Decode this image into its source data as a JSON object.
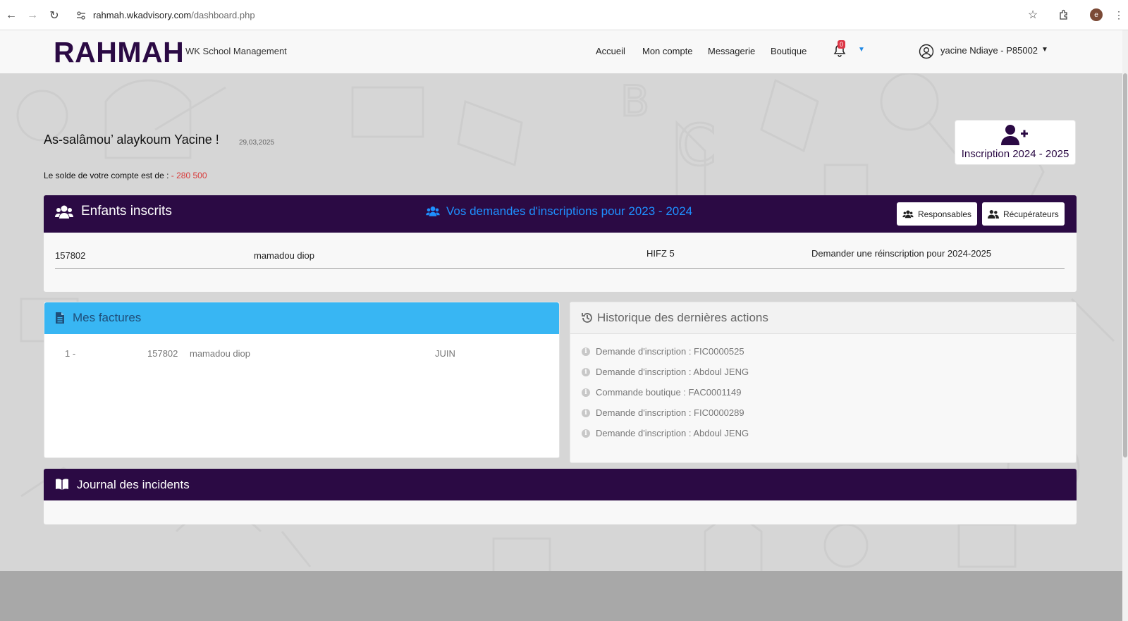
{
  "browser": {
    "url_host": "rahmah.wkadvisory.com",
    "url_path": "/dashboard.php",
    "profile_initial": "e"
  },
  "header": {
    "brand": "RAHMAH",
    "brand_sub": "WK School Management",
    "nav": [
      "Accueil",
      "Mon compte",
      "Messagerie",
      "Boutique"
    ],
    "notification_count": "0",
    "user_name": "yacine Ndiaye - P85002"
  },
  "welcome": {
    "greeting": "As-salâmou’ alaykoum Yacine !",
    "date": "29,03,2025",
    "balance_label": "Le solde de votre compte est de : ",
    "balance_value": "- 280 500"
  },
  "inscription_card": {
    "label": "Inscription 2024 - 2025"
  },
  "enfants": {
    "title": "Enfants inscrits",
    "demandes_link": "Vos demandes d'inscriptions pour 2023 - 2024",
    "btn_responsables": "Responsables",
    "btn_recuperateurs": "Récupérateurs",
    "row": {
      "id": "157802",
      "name": "mamadou diop",
      "level": "HIFZ 5",
      "action": "Demander une réinscription pour 2024-2025"
    }
  },
  "factures": {
    "title": "Mes factures",
    "row": {
      "index": "1 -",
      "id": "157802",
      "name": "mamadou diop",
      "month": "JUIN"
    }
  },
  "historique": {
    "title": "Historique des dernières actions",
    "items": [
      "Demande d'inscription : FIC0000525",
      "Demande d'inscription : Abdoul JENG",
      "Commande boutique : FAC0001149",
      "Demande d'inscription : FIC0000289",
      "Demande d'inscription : Abdoul JENG"
    ]
  },
  "journal": {
    "title": "Journal des incidents"
  },
  "colors": {
    "brand_purple": "#2b0a44",
    "accent_blue": "#38b6f3",
    "link_blue": "#1e90ff",
    "negative_red": "#d83a3a"
  }
}
